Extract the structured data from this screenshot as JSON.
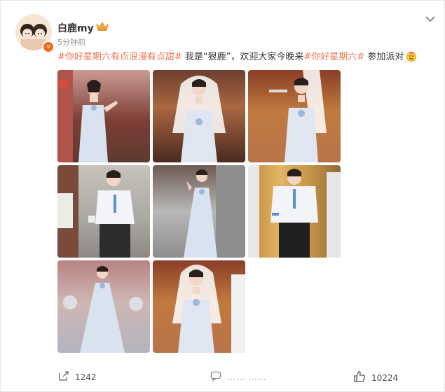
{
  "post": {
    "username": "白鹿my",
    "time": "5分钟前",
    "verified_badge": "v",
    "text": {
      "topic1": "#你好星期六有点浪漫有点甜#",
      "middle": " 我是“狠鹿”，欢迎大家今晚来",
      "topic2": "#你好星期六#",
      "tail": " 参加派对"
    },
    "images": [
      {
        "name": "photo-1"
      },
      {
        "name": "photo-2"
      },
      {
        "name": "photo-3"
      },
      {
        "name": "photo-4"
      },
      {
        "name": "photo-5"
      },
      {
        "name": "photo-6"
      },
      {
        "name": "photo-7"
      },
      {
        "name": "photo-8"
      }
    ]
  },
  "actions": {
    "repost_count": "1242",
    "comment_count": "…… ……",
    "like_count": "10224"
  },
  "colors": {
    "topic": "#eb7350",
    "crown": "#f2a93b",
    "badge": "#f36a1c"
  },
  "icons": [
    "chevron-down-icon",
    "crown-icon",
    "party-emoji-icon",
    "repost-icon",
    "comment-icon",
    "like-icon"
  ]
}
